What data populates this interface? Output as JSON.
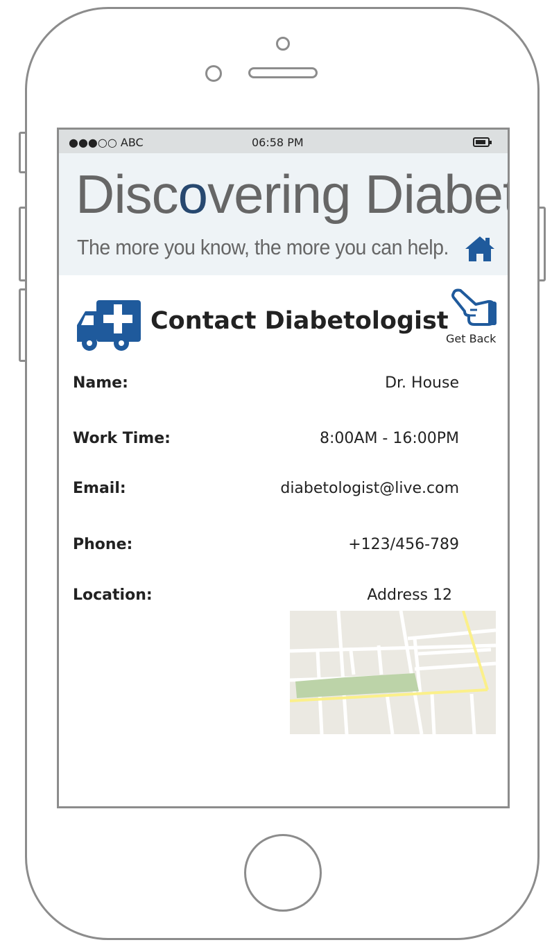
{
  "status_bar": {
    "carrier": "●●●○○ ABC",
    "time": "06:58 PM"
  },
  "banner": {
    "title_pre": "Disc",
    "title_o": "o",
    "title_post": "vering Diabetes",
    "tagline": "The more you know, the more you can help.",
    "accent_color": "#27486f"
  },
  "page": {
    "title": "Contact Diabetologist",
    "back_label": "Get Back"
  },
  "contact": [
    {
      "label": "Name:",
      "value": "Dr. House"
    },
    {
      "label": "Work Time:",
      "value": "8:00AM - 16:00PM"
    },
    {
      "label": "Email:",
      "value": "diabetologist@live.com"
    },
    {
      "label": "Phone:",
      "value": "+123/456-789"
    },
    {
      "label": "Location:",
      "value": "Address 12"
    }
  ],
  "icons": {
    "home": "home-icon",
    "ambulance": "ambulance-icon",
    "back": "pointing-hand-icon",
    "battery": "battery-icon"
  },
  "colors": {
    "icon_blue": "#1f5a9c",
    "status_bar": "#dcdfe0",
    "banner_bg": "#eef3f6"
  }
}
